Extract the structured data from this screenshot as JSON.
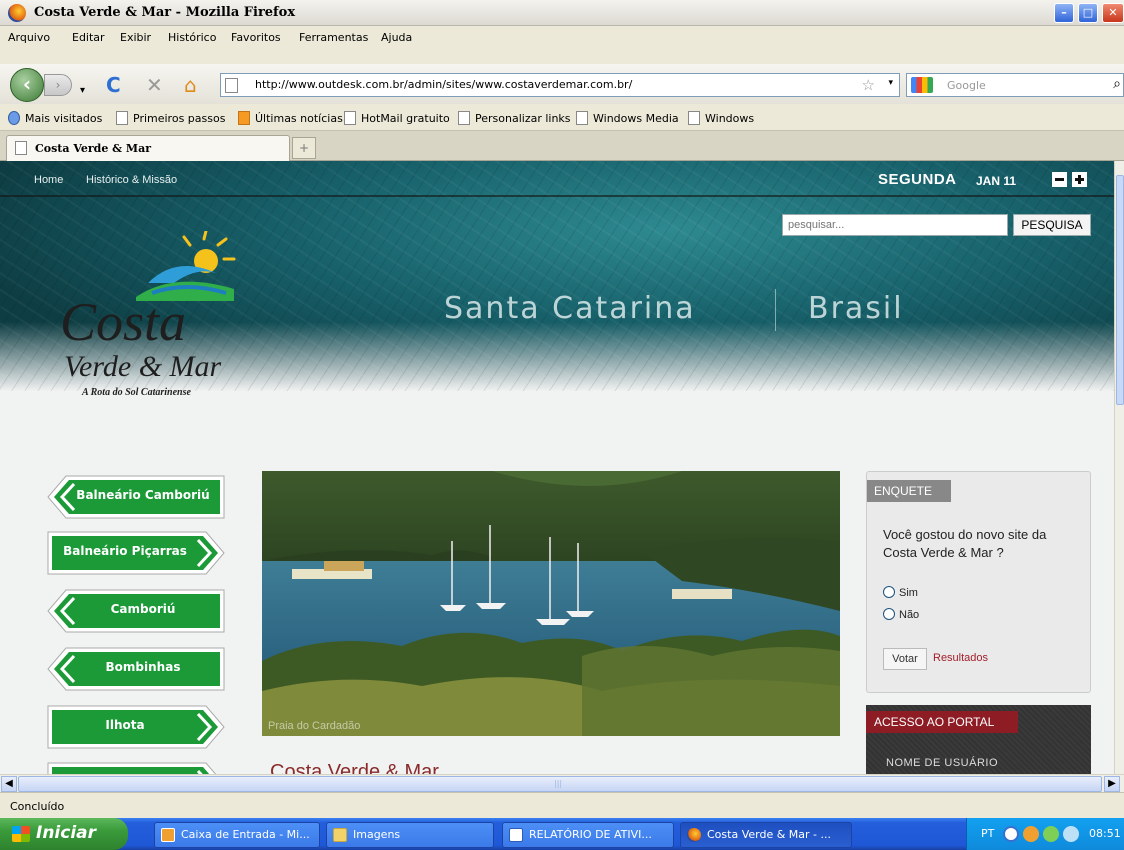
{
  "window": {
    "title": "Costa Verde & Mar - Mozilla Firefox",
    "min_icon": "minimize-icon",
    "max_icon": "maximize-icon",
    "close_icon": "close-icon"
  },
  "menu": [
    "Arquivo",
    "Editar",
    "Exibir",
    "Histórico",
    "Favoritos",
    "Ferramentas",
    "Ajuda"
  ],
  "nav": {
    "url": "http://www.outdesk.com.br/admin/sites/www.costaverdemar.com.br/",
    "search_placeholder": "Google"
  },
  "bookmarks": [
    "Mais visitados",
    "Primeiros passos",
    "Últimas notícias",
    "HotMail gratuito",
    "Personalizar links",
    "Windows Media",
    "Windows"
  ],
  "tab": {
    "label": "Costa Verde & Mar",
    "new_tab": "+"
  },
  "page": {
    "topnav": [
      "Home",
      "Histórico & Missão"
    ],
    "day": "SEGUNDA",
    "date": "JAN 11",
    "search_placeholder": "pesquisar...",
    "search_button": "PESQUISA",
    "tagline_left": "Santa Catarina",
    "tagline_right": "Brasil",
    "logo": {
      "line1": "Costa",
      "line2": "Verde & Mar",
      "line3": "A Rota do Sol Catarinense"
    },
    "signs": [
      {
        "label": "Balneário Camboriú",
        "dir": "left"
      },
      {
        "label": "Balneário Piçarras",
        "dir": "right"
      },
      {
        "label": "Camboriú",
        "dir": "left"
      },
      {
        "label": "Bombinhas",
        "dir": "left"
      },
      {
        "label": "Ilhota",
        "dir": "right"
      },
      {
        "label": "",
        "dir": "right"
      }
    ],
    "photo_caption": "Praia do Cardadão",
    "article_title": "Costa Verde & Mar",
    "poll": {
      "header": "ENQUETE",
      "question": "Você gostou do novo site da Costa Verde & Mar ?",
      "options": [
        "Sim",
        "Não"
      ],
      "vote": "Votar",
      "results": "Resultados"
    },
    "portal": {
      "header": "ACESSO AO PORTAL",
      "username_label": "NOME DE USUÁRIO"
    }
  },
  "status": "Concluído",
  "taskbar": {
    "start": "Iniciar",
    "items": [
      {
        "label": "Caixa de Entrada - Mi...",
        "icon": "outlook-icon"
      },
      {
        "label": "Imagens",
        "icon": "folder-icon"
      },
      {
        "label": "RELATÓRIO DE ATIVI...",
        "icon": "word-icon"
      },
      {
        "label": "Costa Verde & Mar - ...",
        "icon": "firefox-icon"
      }
    ],
    "lang": "PT",
    "clock": "08:51"
  },
  "colors": {
    "poll_results": "#a31f2b",
    "portal_header": "#8e1c25",
    "article_title": "#8a2a2a",
    "sign_green": "#1c9a38"
  }
}
